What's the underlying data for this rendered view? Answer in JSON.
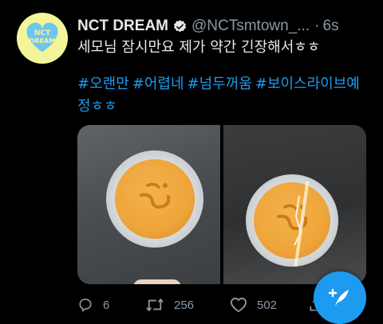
{
  "colors": {
    "accent": "#1d9bf0",
    "secondary_text": "#8b98a5",
    "text": "#e7e9ea",
    "background": "#000000",
    "avatar_bg": "#f4f59a"
  },
  "tweet": {
    "author_name": "NCT DREAM",
    "handle": "@NCTsmtown_...",
    "separator": "·",
    "time": "6s",
    "text": "세모님 잠시만요 제가 약간 긴장해서ㅎㅎ",
    "hashtags": [
      "#오랜만",
      "#어렵네",
      "#넘두꺼움",
      "#보이스라이브예",
      "정ㅎㅎ"
    ],
    "avatar_icon": "nct-dream-heart-logo",
    "verified_icon": "verified-badge-icon"
  },
  "media": {
    "images": [
      "dalgona-candy-image-1",
      "dalgona-candy-image-2"
    ]
  },
  "actions": {
    "reply": {
      "icon": "reply-icon",
      "count": "6"
    },
    "retweet": {
      "icon": "retweet-icon",
      "count": "256"
    },
    "like": {
      "icon": "heart-icon",
      "count": "502"
    },
    "share": {
      "icon": "share-icon"
    }
  },
  "compose_button": {
    "icon": "compose-tweet-icon"
  }
}
